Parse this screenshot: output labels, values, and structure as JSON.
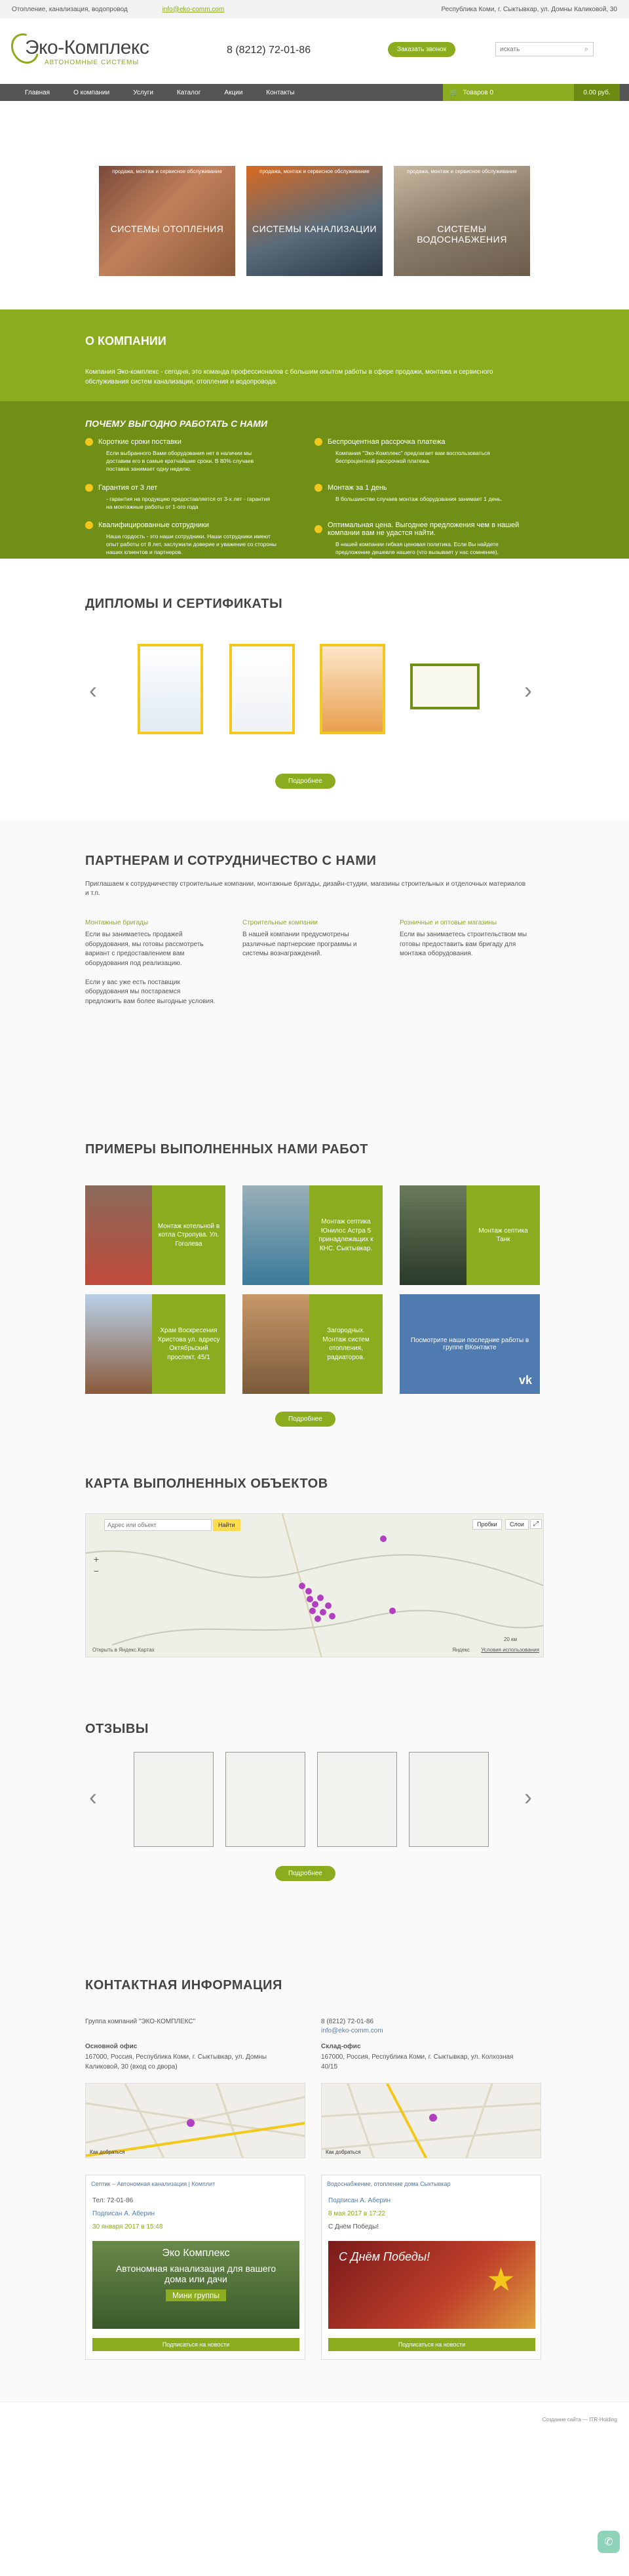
{
  "topbar": {
    "tagline": "Отопление, канализация, водопровод",
    "email": "info@eko-comm.com",
    "address": "Республика Коми, г. Сыктывкар, ул. Домны Каликовой, 30"
  },
  "header": {
    "logo_name": "Эко-Комплекс",
    "logo_sub": "АВТОНОМНЫЕ СИСТЕМЫ",
    "phone": "8 (8212) 72-01-86",
    "call_button": "Заказать звонок",
    "search_placeholder": "искать"
  },
  "nav": {
    "items": [
      "Главная",
      "О компании",
      "Услуги",
      "Каталог",
      "Акции",
      "Контакты"
    ],
    "cart_label": "Товаров 0",
    "cart_total": "0.00 руб."
  },
  "systems": {
    "caption": "продажа, монтаж и сервисное обслуживание",
    "cards": [
      "СИСТЕМЫ ОТОПЛЕНИЯ",
      "СИСТЕМЫ КАНАЛИЗАЦИИ",
      "СИСТЕМЫ ВОДОСНАБЖЕНИЯ"
    ]
  },
  "about": {
    "title": "О КОМПАНИИ",
    "text": "Компания Эко-комплекс - сегодня, это команда профессионалов с большим опытом работы в сфере продажи, монтажа и сервисного обслуживания систем канализации, отопления и водопровода."
  },
  "benefits": {
    "title": "ПОЧЕМУ ВЫГОДНО РАБОТАТЬ С НАМИ",
    "items": [
      {
        "h": "Короткие сроки поставки",
        "t": "Если выбранного Вами оборудования нет в наличии мы доставим его в самые кратчайшие сроки. В 80% случаев поставка занимает одну неделю."
      },
      {
        "h": "Беспроцентная рассрочка платежа",
        "t": "Компания \"Эко-Комплекс\" предлагает вам воспользоваться беспроцентной рассрочкой платежа."
      },
      {
        "h": "Гарантия от 3 лет",
        "t": "- гарантия на продукцию предоставляется от 3-х лет - гарантия на монтажные работы от 1-ого года"
      },
      {
        "h": "Монтаж за 1 день",
        "t": "В большинстве случаев монтаж оборудования занимает 1 день."
      },
      {
        "h": "Квалифицированные сотрудники",
        "t": "Наша гордость - это наши сотрудники. Наши сотрудники имеют опыт работы от 8 лет, заслужили доверие и уважение со стороны наших клиентов и партнеров."
      },
      {
        "h": "Оптимальная цена. Выгоднее предложения чем в нашей компании вам не удастся найти.",
        "t": "В нашей компании гибкая ценовая политика. Если Вы найдете предложение дешевле нашего (что вызывает у нас сомнение), мы всегда найдем договориться с вами и сделаем вам предложение еще выгоднее."
      }
    ]
  },
  "diplomas": {
    "title": "ДИПЛОМЫ И СЕРТИФИКАТЫ",
    "more": "Подробнее"
  },
  "partners": {
    "title": "ПАРТНЕРАМ И СОТРУДНИЧЕСТВО С НАМИ",
    "intro": "Приглашаем к сотрудничеству строительные компании, монтажные бригады, дизайн-студии, магазины строительных и отделочных материалов и т.п.",
    "cols": [
      {
        "h": "Монтажные бригады",
        "t": "Если вы занимаетесь продажей оборудования, мы готовы рассмотреть вариант с предоставлением вам оборудования под реализацию.\n\nЕсли у вас уже есть поставщик оборудования мы постараемся предложить вам более выгодные условия."
      },
      {
        "h": "Строительные компании",
        "t": "В нашей компании предусмотрены различные партнерские программы и системы вознаграждений."
      },
      {
        "h": "Розничные и оптовые магазины",
        "t": "Если вы занимаетесь строительством мы готовы предоставить вам бригаду для монтажа оборудования."
      }
    ]
  },
  "works": {
    "title": "ПРИМЕРЫ ВЫПОЛНЕННЫХ НАМИ РАБОТ",
    "items": [
      "Монтаж котельной в котла Стропува. Ул. Гоголева",
      "Монтаж септика Юнилос Астра 5 принадлежащих к КНС. Сыктывкар.",
      "Монтаж септика Танк",
      "Храм Воскресения Христова ул. адресу Октябрьский проспект, 45/1",
      "Загородных. Монтаж систем отопления, радиаторов."
    ],
    "vk_text": "Посмотрите наши последние работы в группе ВКонтакте",
    "more": "Подробнее"
  },
  "map": {
    "title": "КАРТА ВЫПОЛНЕННЫХ ОБЪЕКТОВ",
    "search_placeholder": "Адрес или объект",
    "find": "Найти",
    "traffic": "Пробки",
    "layers": "Слои",
    "open_link": "Открыть в Яндекс.Картах",
    "scale": "20 км",
    "terms": "Условия использования",
    "yandex": "Яндекс"
  },
  "reviews": {
    "title": "ОТЗЫВЫ",
    "more": "Подробнее"
  },
  "contacts": {
    "title": "КОНТАКТНАЯ ИНФОРМАЦИЯ",
    "group": "Группа компаний \"ЭКО-КОМПЛЕКС\"",
    "phone": "8 (8212) 72-01-86",
    "email": "info@eko-comm.com",
    "office_title": "Основной офис",
    "office_addr": "167000, Россия, Республика Коми, г. Сыктывкар, ул. Домны Каликовой, 30 (вход со двора)",
    "store_title": "Склад-офис",
    "store_addr": "167000, Россия, Республика Коми, г. Сыктывкар, ул. Колхозная 40/15",
    "map_link": "Как добраться",
    "vk1_name": "Септик – Автономная канализация | Комплит",
    "vk1_phone": "Тел: 72-01-86",
    "vk1_date": "30 января 2017 в 15:48",
    "vk1_banner1": "Эко Комплекс",
    "vk1_banner2": "Автономная канализация для вашего дома или дачи",
    "vk1_banner3": "Мини группы",
    "vk2_name": "Водоснабжение, отопление дома Сыктывкар",
    "vk2_date": "8 мая 2017 в 17:22",
    "vk2_text": "С Днём Победы!",
    "vk2_banner": "С Днём Победы!",
    "subscribe": "Подписаться на новости",
    "subscribed_by": "Подписан А. Аберин"
  },
  "footer": {
    "copy": "Создание сайта — ITR-Holding"
  }
}
